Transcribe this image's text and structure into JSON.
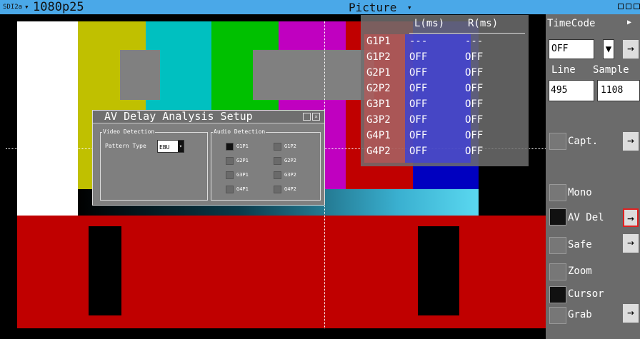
{
  "top_bar": {
    "source": "SDI2a",
    "dropdown": "▾",
    "format": "1080p25",
    "view": "Picture",
    "view_dropdown": "▾"
  },
  "table": {
    "col_l": "L(ms)",
    "col_r": "R(ms)",
    "rows": [
      {
        "name": "G1P1",
        "l": "---",
        "r": "---"
      },
      {
        "name": "G1P2",
        "l": "OFF",
        "r": "OFF"
      },
      {
        "name": "G2P1",
        "l": "OFF",
        "r": "OFF"
      },
      {
        "name": "G2P2",
        "l": "OFF",
        "r": "OFF"
      },
      {
        "name": "G3P1",
        "l": "OFF",
        "r": "OFF"
      },
      {
        "name": "G3P2",
        "l": "OFF",
        "r": "OFF"
      },
      {
        "name": "G4P1",
        "l": "OFF",
        "r": "OFF"
      },
      {
        "name": "G4P2",
        "l": "OFF",
        "r": "OFF"
      }
    ]
  },
  "dialog": {
    "title": "AV Delay Analysis Setup",
    "video_group": "Video Detection",
    "pattern_label": "Pattern Type",
    "pattern_value": "EBU",
    "audio_group": "Audio Detection",
    "checkboxes": [
      {
        "label": "G1P1",
        "checked": true
      },
      {
        "label": "G1P2",
        "checked": false
      },
      {
        "label": "G2P1",
        "checked": false
      },
      {
        "label": "G2P2",
        "checked": false
      },
      {
        "label": "G3P1",
        "checked": false
      },
      {
        "label": "G3P2",
        "checked": false
      },
      {
        "label": "G4P1",
        "checked": false
      },
      {
        "label": "G4P2",
        "checked": false
      }
    ]
  },
  "panel": {
    "timecode_label": "TimeCode",
    "timecode_value": "OFF",
    "line_label": "Line",
    "sample_label": "Sample",
    "line_value": "495",
    "sample_value": "1108",
    "capt": "Capt.",
    "mono": "Mono",
    "av_del": "AV Del",
    "safe": "Safe",
    "zoom": "Zoom",
    "cursor": "Cursor",
    "grab": "Grab",
    "arrow": "→"
  },
  "colors": {
    "accent": "#4aa8e8",
    "active_border": "#e02020"
  }
}
